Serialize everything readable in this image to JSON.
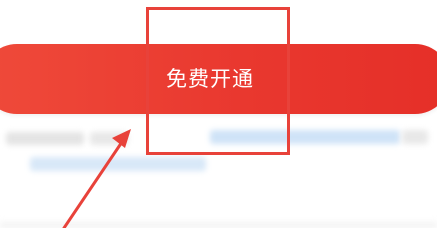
{
  "cta": {
    "label": "免费开通"
  },
  "colors": {
    "button_start": "#ef4a3a",
    "button_end": "#e52f28",
    "highlight": "#e8423a",
    "blur_blue": "#cfe3f7",
    "blur_gray": "#e6e6e6"
  },
  "icons": {
    "annotation_arrow": "arrow-pointer-icon"
  }
}
